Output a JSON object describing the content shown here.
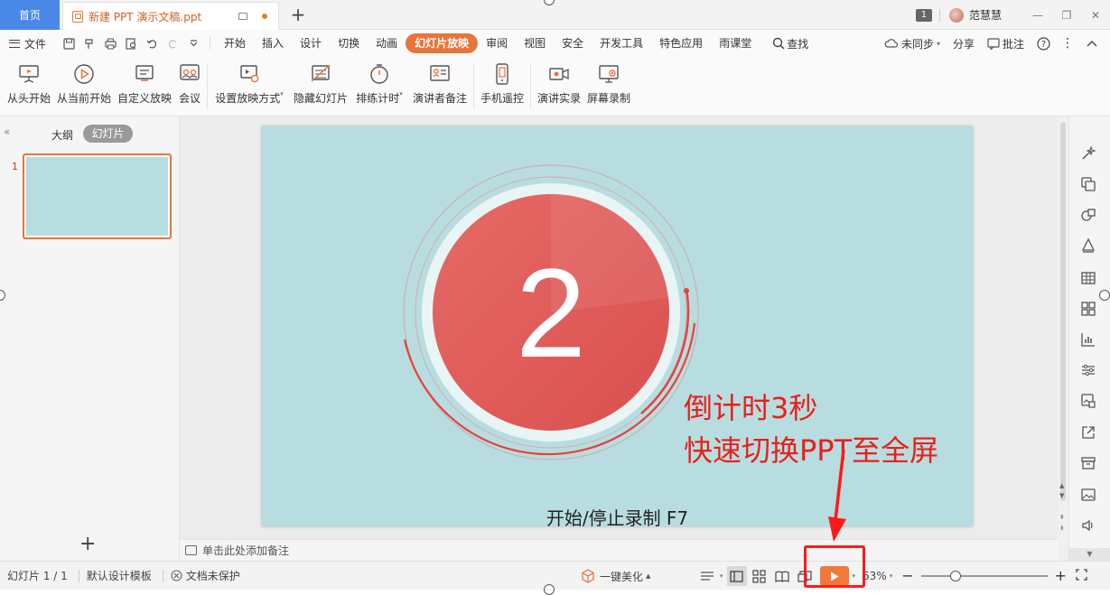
{
  "tabs": {
    "home_label": "首页",
    "doc_title": "新建 PPT 演示文稿.ppt",
    "add_label": "+"
  },
  "titlebar": {
    "page_badge": "1",
    "user_name": "范慧慧",
    "minimize": "—",
    "restore": "❐",
    "close": "✕"
  },
  "menubar": {
    "file_label": "文件",
    "items": [
      "开始",
      "插入",
      "设计",
      "切换",
      "动画",
      "幻灯片放映",
      "审阅",
      "视图",
      "安全",
      "开发工具",
      "特色应用",
      "雨课堂"
    ],
    "active_item": "幻灯片放映",
    "search_label": "查找",
    "sync_label": "未同步",
    "share_label": "分享",
    "comment_label": "批注"
  },
  "ribbon": {
    "buttons": [
      {
        "label": "从头开始",
        "icon": "projector-icon"
      },
      {
        "label": "从当前开始",
        "icon": "play-circle-icon"
      },
      {
        "label": "自定义放映",
        "icon": "custom-show-icon"
      },
      {
        "label": "会议",
        "icon": "meeting-icon"
      },
      {
        "label": "设置放映方式",
        "icon": "slideshow-settings-icon"
      },
      {
        "label": "隐藏幻灯片",
        "icon": "hide-slide-icon"
      },
      {
        "label": "排练计时",
        "icon": "stopwatch-icon"
      },
      {
        "label": "演讲者备注",
        "icon": "speaker-notes-icon"
      },
      {
        "label": "手机遥控",
        "icon": "phone-remote-icon"
      },
      {
        "label": "演讲实录",
        "icon": "video-record-icon"
      },
      {
        "label": "屏幕录制",
        "icon": "screen-record-icon"
      }
    ]
  },
  "leftpanel": {
    "collapse_glyph": "«",
    "tab_outline": "大纲",
    "tab_slides": "幻灯片",
    "slide_number": "1",
    "add_glyph": "+"
  },
  "slide": {
    "countdown_number": "2",
    "caption": "开始/停止录制  F7",
    "bg_color": "#b8dde0",
    "circle_color": "#e05a58"
  },
  "annotation": {
    "line1": "倒计时3秒",
    "line2": "快速切换PPT至全屏",
    "color": "#e8201a"
  },
  "notes": {
    "placeholder": "单击此处添加备注"
  },
  "statusbar": {
    "slide_info": "幻灯片 1 / 1",
    "template": "默认设计模板",
    "protection": "文档未保护",
    "beautify": "一键美化",
    "zoom": "63%",
    "zoom_fraction": 0.27
  },
  "colors": {
    "accent": "#e8743b",
    "home_tab": "#4a88e8",
    "annotation_box": "#ff1a1a"
  }
}
